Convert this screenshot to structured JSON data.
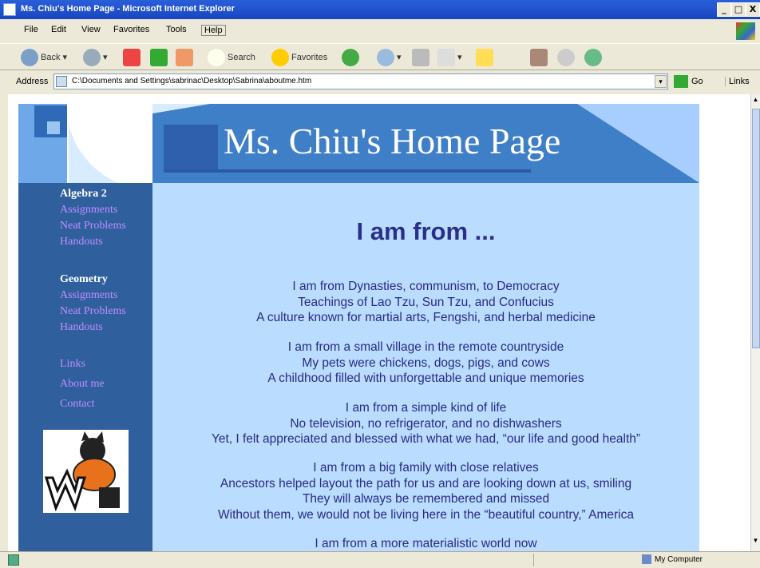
{
  "window": {
    "title": "Ms. Chiu's Home Page - Microsoft Internet Explorer",
    "controls": [
      "_",
      "□",
      "X"
    ]
  },
  "menu": [
    "File",
    "Edit",
    "View",
    "Favorites",
    "Tools",
    "Help"
  ],
  "toolbar": {
    "back": "Back",
    "search": "Search",
    "favorites": "Favorites"
  },
  "address": {
    "label": "Address",
    "value": "C:\\Documents and Settings\\sabrinac\\Desktop\\Sabrina\\aboutme.htm",
    "go": "Go",
    "links": "Links"
  },
  "status": {
    "zone": "My Computer"
  },
  "page": {
    "banner_title": "Ms. Chiu's Home Page",
    "nav": [
      {
        "heading": "Algebra 2",
        "links": [
          "Assignments",
          "Neat Problems",
          "Handouts"
        ]
      },
      {
        "heading": "Geometry",
        "links": [
          "Assignments",
          "Neat Problems",
          "Handouts"
        ]
      }
    ],
    "nav_extra": [
      "Links",
      "About me",
      "Contact"
    ],
    "heading": "I am from ...",
    "stanzas": [
      [
        "I am from Dynasties, communism, to Democracy",
        "Teachings of Lao Tzu, Sun Tzu, and Confucius",
        "A culture known for martial arts, Fengshi, and herbal medicine"
      ],
      [
        "I am from a small village in the remote countryside",
        "My pets were chickens, dogs, pigs, and cows",
        "A childhood filled with unforgettable and unique memories"
      ],
      [
        "I am from a simple kind of life",
        "No television, no refrigerator, and no dishwashers",
        "Yet, I felt appreciated and blessed with what we had, “our life and good health”"
      ],
      [
        "I am from a big family with close relatives",
        "Ancestors helped layout the path for us and are looking down at us, smiling",
        "They will always be remembered and missed",
        "Without them, we would not be living here in the “beautiful country,” America"
      ],
      [
        "I am from a more materialistic world now"
      ]
    ]
  },
  "colors": {
    "banner": "#3f7fc8",
    "sidebar": "#2f609d",
    "content": "#b9dcff",
    "heading": "#2b2f8a",
    "nav_link": "#c08cff"
  }
}
